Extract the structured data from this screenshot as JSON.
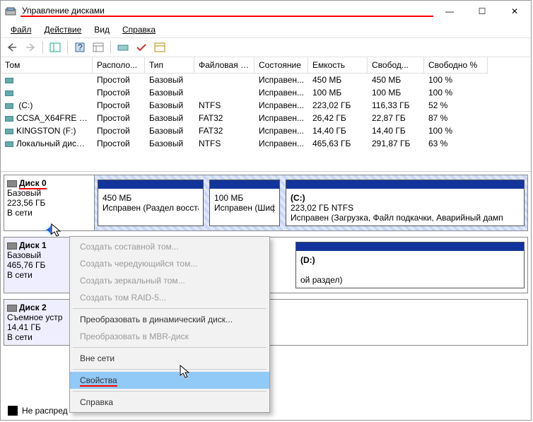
{
  "window": {
    "title": "Управление дисками",
    "buttons": {
      "min": "—",
      "max": "☐",
      "close": "✕"
    }
  },
  "menu": {
    "file": "Файл",
    "action": "Действие",
    "view": "Вид",
    "help": "Справка"
  },
  "columns": [
    "Том",
    "Располо...",
    "Тип",
    "Файловая с...",
    "Состояние",
    "Емкость",
    "Свобод...",
    "Свободно %"
  ],
  "volumes": [
    {
      "name": "",
      "layout": "Простой",
      "type": "Базовый",
      "fs": "",
      "status": "Исправен...",
      "cap": "450 МБ",
      "free": "450 МБ",
      "pct": "100 %"
    },
    {
      "name": "",
      "layout": "Простой",
      "type": "Базовый",
      "fs": "",
      "status": "Исправен...",
      "cap": "100 МБ",
      "free": "100 МБ",
      "pct": "100 %"
    },
    {
      "name": " (C:)",
      "layout": "Простой",
      "type": "Базовый",
      "fs": "NTFS",
      "status": "Исправен...",
      "cap": "223,02 ГБ",
      "free": "116,33 ГБ",
      "pct": "52 %"
    },
    {
      "name": "CCSA_X64FRE (G:)",
      "layout": "Простой",
      "type": "Базовый",
      "fs": "FAT32",
      "status": "Исправен...",
      "cap": "26,42 ГБ",
      "free": "22,87 ГБ",
      "pct": "87 %"
    },
    {
      "name": "KINGSTON (F:)",
      "layout": "Простой",
      "type": "Базовый",
      "fs": "FAT32",
      "status": "Исправен...",
      "cap": "14,40 ГБ",
      "free": "14,40 ГБ",
      "pct": "100 %"
    },
    {
      "name": "Локальный диск (...",
      "layout": "Простой",
      "type": "Базовый",
      "fs": "NTFS",
      "status": "Исправен...",
      "cap": "465,63 ГБ",
      "free": "291,87 ГБ",
      "pct": "63 %"
    }
  ],
  "disk0": {
    "name": "Диск 0",
    "type": "Базовый",
    "size": "223,56 ГБ",
    "status": "В сети",
    "p1": {
      "l1": "450 МБ",
      "l2": "Исправен (Раздел восстан"
    },
    "p2": {
      "l1": "100 МБ",
      "l2": "Исправен (Шифро"
    },
    "p3": {
      "t": "(C:)",
      "l1": "223,02 ГБ NTFS",
      "l2": "Исправен (Загрузка, Файл подкачки, Аварийный дамп"
    }
  },
  "disk1": {
    "name": "Диск 1",
    "type": "Базовый",
    "size": "465,76 ГБ",
    "status": "В сети",
    "p1": {
      "t": "(D:)",
      "l2": "ой раздел)"
    }
  },
  "disk2": {
    "name": "Диск 2",
    "type": "Съемное устр",
    "size": "14,41 ГБ",
    "status": "В сети"
  },
  "legend": "Не распред",
  "ctx": {
    "i1": "Создать составной том...",
    "i2": "Создать чередующийся том...",
    "i3": "Создать зеркальный том...",
    "i4": "Создать том RAID-5...",
    "i5": "Преобразовать в динамический диск...",
    "i6": "Преобразовать в MBR-диск",
    "i7": "Вне сети",
    "i8": "Свойства",
    "i9": "Справка"
  }
}
